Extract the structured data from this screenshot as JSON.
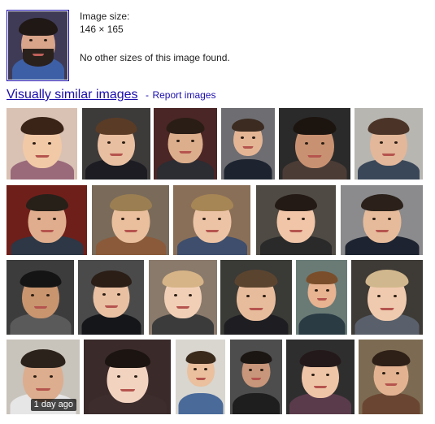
{
  "info": {
    "size_label": "Image size:",
    "size_value": "146 × 165",
    "no_other_sizes": "No other sizes of this image found."
  },
  "heading": {
    "similar_link": "Visually similar images",
    "separator": "-",
    "report_link": "Report images"
  },
  "colors": {
    "link": "#1a0dab",
    "badge_bg": "#000000"
  },
  "results": [
    {
      "skin": "#f1c9a6",
      "hair": "#3a2418",
      "bg": "#d9c2b4",
      "shirt": "#9a6a7a"
    },
    {
      "skin": "#e8bfa0",
      "hair": "#5a3c26",
      "bg": "#3d3a3a",
      "shirt": "#1c1c22"
    },
    {
      "skin": "#dcae8c",
      "hair": "#2a1d16",
      "bg": "#4a2626",
      "shirt": "#2c2c33"
    },
    {
      "skin": "#e4b595",
      "hair": "#3b2b20",
      "bg": "#6e6e72",
      "shirt": "#1d2430"
    },
    {
      "skin": "#c89272",
      "hair": "#1c140f",
      "bg": "#2a2a2a",
      "shirt": "#4b3c36"
    },
    {
      "skin": "#e3b799",
      "hair": "#4b3427",
      "bg": "#b8b6b1",
      "shirt": "#3a4758"
    },
    {
      "skin": "#e0ae8e",
      "hair": "#262019",
      "bg": "#6f1f1a",
      "shirt": "#2d3745"
    },
    {
      "skin": "#e9bf9d",
      "hair": "#9b7f52",
      "bg": "#7a6a5a",
      "shirt": "#8a5a3a"
    },
    {
      "skin": "#ecc3a5",
      "hair": "#a78655",
      "bg": "#8a6f58",
      "shirt": "#3e4e6c"
    },
    {
      "skin": "#f0c5a8",
      "hair": "#241a15",
      "bg": "#4f4b44",
      "shirt": "#2a2a2a"
    },
    {
      "skin": "#e6bb9b",
      "hair": "#2b211a",
      "bg": "#8b8b8d",
      "shirt": "#1d2330"
    },
    {
      "skin": "#c8956f",
      "hair": "#141414",
      "bg": "#3c3c3c",
      "shirt": "#5a5a5a"
    },
    {
      "skin": "#e9c0a2",
      "hair": "#2a1e17",
      "bg": "#4a4a4a",
      "shirt": "#15161a"
    },
    {
      "skin": "#f1cfb7",
      "hair": "#d6b487",
      "bg": "#8a7a6c",
      "shirt": "#3b3b3b"
    },
    {
      "skin": "#e7bc9c",
      "hair": "#5a4430",
      "bg": "#3a3a36",
      "shirt": "#1e1e22"
    },
    {
      "skin": "#e7b391",
      "hair": "#7a4e2a",
      "bg": "#6a7b76",
      "shirt": "#2a3b44"
    },
    {
      "skin": "#f0caae",
      "hair": "#d1b78d",
      "bg": "#3e3a35",
      "shirt": "#59606b"
    },
    {
      "skin": "#dcad8e",
      "hair": "#2b221c",
      "bg": "#c8c3bb",
      "shirt": "#e6e6e6",
      "badge": "1 day ago"
    },
    {
      "skin": "#f2d3c0",
      "hair": "#1b1410",
      "bg": "#3a2a2a",
      "shirt": "#3d2d2d"
    },
    {
      "skin": "#eac09e",
      "hair": "#3a2a1c",
      "bg": "#d8d6cf",
      "shirt": "#4a6a9a"
    },
    {
      "skin": "#c8967a",
      "hair": "#1c1612",
      "bg": "#4d4d4d",
      "shirt": "#1e1e1e"
    },
    {
      "skin": "#efc5a7",
      "hair": "#24191a",
      "bg": "#2e2e2e",
      "shirt": "#5a3b4b"
    },
    {
      "skin": "#e3b391",
      "hair": "#2e1f17",
      "bg": "#7c6b52",
      "shirt": "#6a4632"
    }
  ]
}
